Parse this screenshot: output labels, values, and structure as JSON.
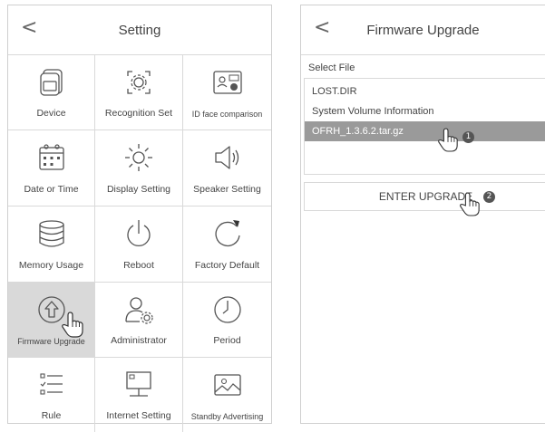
{
  "left_screen": {
    "title": "Setting",
    "back_glyph": "<",
    "items": [
      {
        "label": "Device",
        "icon": "device-icon"
      },
      {
        "label": "Recognition Set",
        "icon": "face-scan-gear-icon"
      },
      {
        "label": "ID face comparison",
        "icon": "id-card-face-icon"
      },
      {
        "label": "Date or Time",
        "icon": "calendar-icon"
      },
      {
        "label": "Display Setting",
        "icon": "brightness-icon"
      },
      {
        "label": "Speaker Setting",
        "icon": "speaker-icon"
      },
      {
        "label": "Memory Usage",
        "icon": "database-icon"
      },
      {
        "label": "Reboot",
        "icon": "power-icon"
      },
      {
        "label": "Factory Default",
        "icon": "reset-icon"
      },
      {
        "label": "Firmware Upgrade",
        "icon": "upload-arrow-icon",
        "selected": true
      },
      {
        "label": "Administrator",
        "icon": "admin-gear-icon"
      },
      {
        "label": "Period",
        "icon": "clock-icon"
      },
      {
        "label": "Rule",
        "icon": "checklist-icon"
      },
      {
        "label": "Internet Setting",
        "icon": "network-icon"
      },
      {
        "label": "Standby Advertising",
        "icon": "image-icon"
      }
    ]
  },
  "right_screen": {
    "title": "Firmware Upgrade",
    "back_glyph": "<",
    "select_file_label": "Select File",
    "files": [
      "LOST.DIR",
      "System Volume Information",
      "OFRH_1.3.6.2.tar.gz"
    ],
    "selected_file_index": 2,
    "upgrade_button": "ENTER UPGRADE",
    "step_badges": [
      "1",
      "2"
    ]
  },
  "colors": {
    "selected_bg": "#d9d9d9",
    "selected_file_bg": "#9a9a9a",
    "border": "#d9d9d9",
    "text": "#444444"
  }
}
